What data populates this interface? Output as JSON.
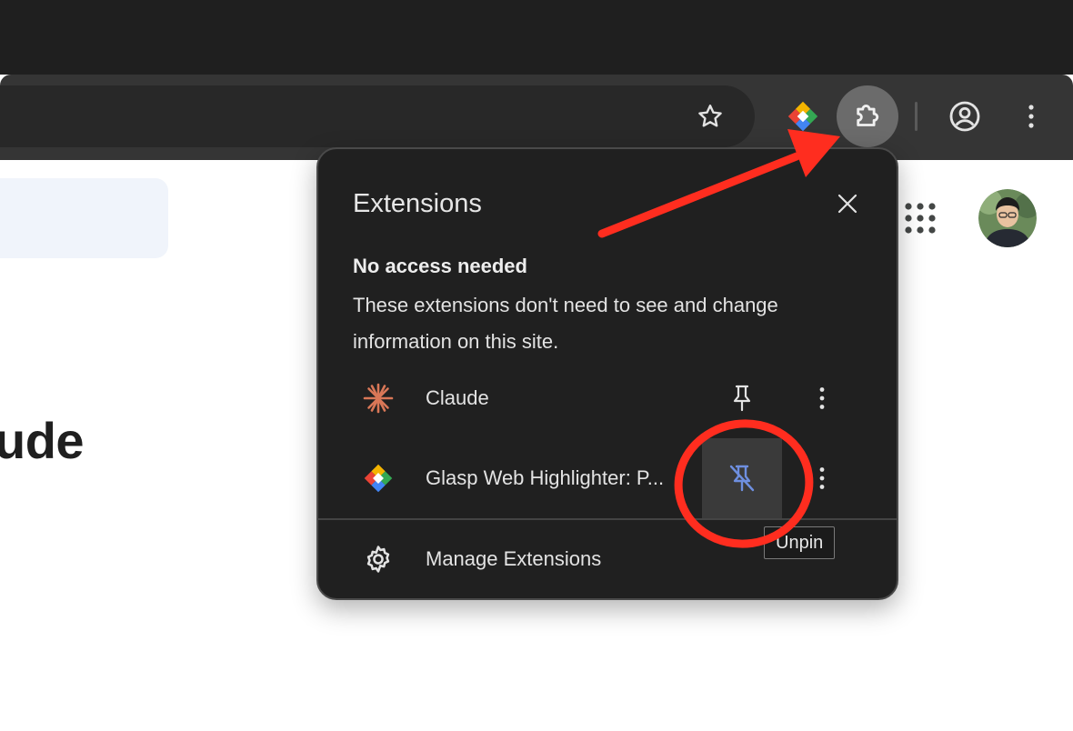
{
  "toolbar": {
    "bookmark_icon": "star-icon",
    "pinned_extension_icon": "glasp-icon",
    "extensions_icon": "puzzle-icon",
    "profile_icon": "profile-icon",
    "menu_icon": "kebab-menu-icon"
  },
  "page": {
    "heading": "ude",
    "apps_icon": "apps-grid-icon"
  },
  "popup": {
    "title": "Extensions",
    "close_icon": "close-icon",
    "section_heading": "No access needed",
    "section_description": "These extensions don't need to see and change information on this site.",
    "extensions": [
      {
        "name": "Claude",
        "icon": "claude-icon",
        "pin_state": "pinned"
      },
      {
        "name": "Glasp Web Highlighter: P...",
        "icon": "glasp-icon",
        "pin_state": "unpin-hover"
      }
    ],
    "manage_label": "Manage Extensions",
    "manage_icon": "gear-icon",
    "tooltip": "Unpin"
  },
  "colors": {
    "annotation": "#ff2d1f",
    "popup_bg": "#202020",
    "toolbar_bg": "#353535",
    "tabstrip_bg": "#1f1f1f",
    "unpin_icon": "#6e8fe0",
    "claude_icon": "#d97757"
  }
}
